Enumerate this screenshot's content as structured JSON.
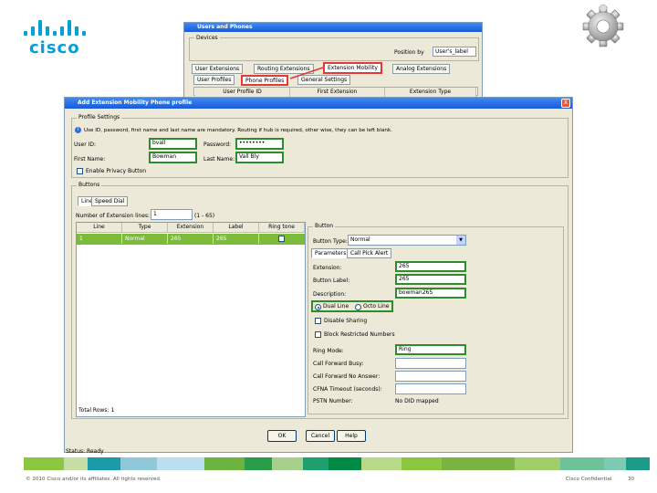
{
  "logo": {
    "text": "cisco",
    "color": "#049fd9"
  },
  "back_window": {
    "title": "Users and Phones",
    "group_devices": "Devices",
    "position_label": "Position by",
    "position_value": "User's_label",
    "tabs": [
      "User Extensions",
      "Routing Extensions",
      "Extension Mobility",
      "Analog Extensions"
    ],
    "subtabs": [
      "User Profiles",
      "Phone Profiles",
      "General Settings"
    ],
    "columns": [
      "User Profile ID",
      "First Extension",
      "Extension Type"
    ]
  },
  "dialog": {
    "title": "Add Extension Mobility Phone profile",
    "close": "X",
    "profile_group": "Profile Settings",
    "info_text": "Use ID, password, first name and last name are mandatory. Routing if hub is required, other wise, they can be left blank.",
    "user_id_label": "User ID:",
    "user_id_value": "bvall",
    "password_label": "Password:",
    "password_value": "••••••••",
    "first_name_label": "First Name:",
    "first_name_value": "Bowman",
    "last_name_label": "Last Name:",
    "last_name_value": "Vall Bly",
    "privacy_label": "Enable Privacy Button",
    "buttons_group": "Buttons",
    "inner_tabs": [
      "Line",
      "Speed Dial"
    ],
    "num_extensions_label": "Number of Extension lines:",
    "num_extensions_value": "1",
    "num_extensions_range": "(1 - 65)",
    "table_columns": [
      "Line",
      "Type",
      "Extension",
      "Label",
      "Ring tone"
    ],
    "table_rows": [
      {
        "line": "1",
        "type": "Normal",
        "extension": "265",
        "label": "265"
      }
    ],
    "total_rows": "Total Rows: 1",
    "button_group": "Button",
    "button_type_label": "Button Type:",
    "button_type_value": "Normal",
    "sub_tabs": [
      "Parameters",
      "Call Pick Alert"
    ],
    "extension_label": "Extension:",
    "extension_value": "265",
    "button_label_label": "Button Label:",
    "button_label_value": "265",
    "description_label": "Description:",
    "description_value": "bowman265",
    "dual_line": "Dual Line",
    "octo_line": "Octo Line",
    "disable_sharing": "Disable Sharing",
    "block_restricted": "Block Restricted Numbers",
    "ring_mode_label": "Ring Mode:",
    "ring_mode_value": "Ring",
    "call_fwd_busy_label": "Call Forward Busy:",
    "call_fwd_no_answer_label": "Call Forward No Answer:",
    "cfna_timeout_label": "CFNA Timeout (seconds):",
    "pstn_label": "PSTN Number:",
    "pstn_value": "No DID mapped",
    "ok": "OK",
    "cancel": "Cancel",
    "help": "Help"
  },
  "status_bar": "Status: Ready",
  "footer": {
    "copyright": "© 2010 Cisco and/or its affiliates. All rights reserved.",
    "confidential": "Cisco Confidential",
    "page_number": "30"
  }
}
